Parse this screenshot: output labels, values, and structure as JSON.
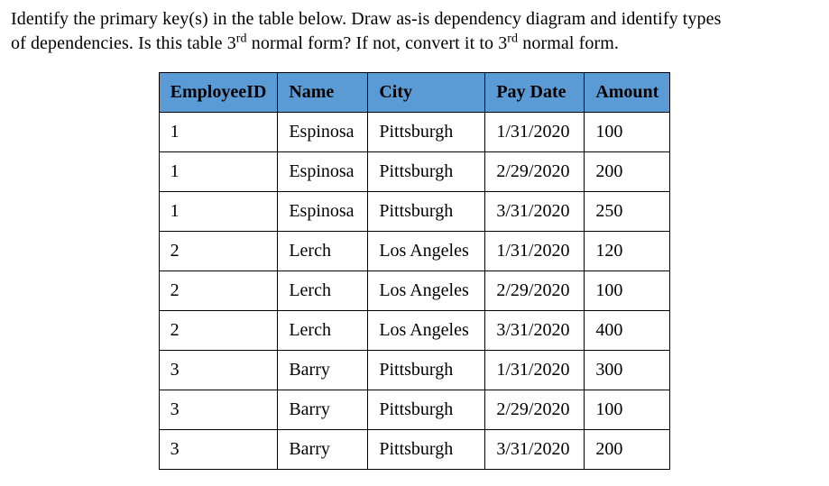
{
  "question": {
    "line1": "Identify the primary key(s) in the table below. Draw as-is dependency diagram and identify types",
    "line2_a": "of dependencies. Is this table 3",
    "line2_sup1": "rd",
    "line2_b": " normal form? If not, convert it to 3",
    "line2_sup2": "rd",
    "line2_c": " normal form."
  },
  "table": {
    "headers": {
      "employeeId": "EmployeeID",
      "name": "Name",
      "city": "City",
      "payDate": "Pay Date",
      "amount": "Amount"
    },
    "rows": [
      {
        "employeeId": "1",
        "name": "Espinosa",
        "city": "Pittsburgh",
        "payDate": "1/31/2020",
        "amount": "100"
      },
      {
        "employeeId": "1",
        "name": "Espinosa",
        "city": "Pittsburgh",
        "payDate": "2/29/2020",
        "amount": "200"
      },
      {
        "employeeId": "1",
        "name": "Espinosa",
        "city": "Pittsburgh",
        "payDate": "3/31/2020",
        "amount": "250"
      },
      {
        "employeeId": "2",
        "name": "Lerch",
        "city": "Los Angeles",
        "payDate": "1/31/2020",
        "amount": "120"
      },
      {
        "employeeId": "2",
        "name": "Lerch",
        "city": "Los Angeles",
        "payDate": "2/29/2020",
        "amount": "100"
      },
      {
        "employeeId": "2",
        "name": "Lerch",
        "city": "Los Angeles",
        "payDate": "3/31/2020",
        "amount": "400"
      },
      {
        "employeeId": "3",
        "name": "Barry",
        "city": "Pittsburgh",
        "payDate": "1/31/2020",
        "amount": "300"
      },
      {
        "employeeId": "3",
        "name": "Barry",
        "city": "Pittsburgh",
        "payDate": "2/29/2020",
        "amount": "100"
      },
      {
        "employeeId": "3",
        "name": "Barry",
        "city": "Pittsburgh",
        "payDate": "3/31/2020",
        "amount": "200"
      }
    ]
  }
}
